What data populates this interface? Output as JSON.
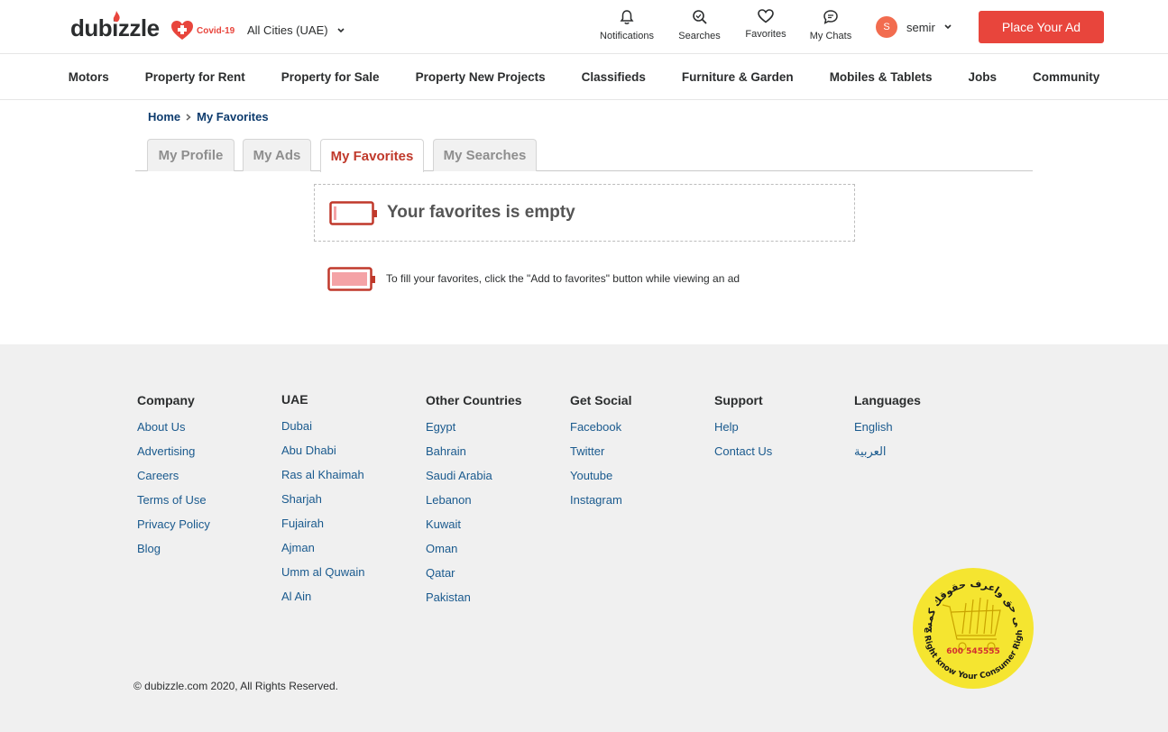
{
  "header": {
    "logo": "dubizzle",
    "covid": "Covid-19",
    "city": "All Cities (UAE)",
    "icons": [
      {
        "label": "Notifications",
        "icon": "bell-icon"
      },
      {
        "label": "Searches",
        "icon": "search-icon"
      },
      {
        "label": "Favorites",
        "icon": "heart-icon"
      },
      {
        "label": "My Chats",
        "icon": "chat-icon"
      }
    ],
    "user": {
      "initial": "S",
      "name": "semir"
    },
    "place_ad": "Place Your Ad"
  },
  "nav": [
    "Motors",
    "Property for Rent",
    "Property for Sale",
    "Property New Projects",
    "Classifieds",
    "Furniture & Garden",
    "Mobiles & Tablets",
    "Jobs",
    "Community"
  ],
  "breadcrumb": {
    "home": "Home",
    "current": "My Favorites"
  },
  "tabs": [
    "My Profile",
    "My Ads",
    "My Favorites",
    "My Searches"
  ],
  "active_tab": "My Favorites",
  "empty": {
    "title": "Your favorites is empty",
    "hint": "To fill your favorites, click the \"Add to favorites\" button while viewing an ad"
  },
  "footer": {
    "columns": [
      {
        "title": "Company",
        "links": [
          "About Us",
          "Advertising",
          "Careers",
          "Terms of Use",
          "Privacy Policy",
          "Blog"
        ]
      },
      {
        "title": "UAE",
        "links": [
          "Dubai",
          "Abu Dhabi",
          "Ras al Khaimah",
          "Sharjah",
          "Fujairah",
          "Ajman",
          "Umm al Quwain",
          "Al Ain"
        ]
      },
      {
        "title": "Other Countries",
        "links": [
          "Egypt",
          "Bahrain",
          "Saudi Arabia",
          "Lebanon",
          "Kuwait",
          "Oman",
          "Qatar",
          "Pakistan"
        ]
      },
      {
        "title": "Get Social",
        "links": [
          "Facebook",
          "Twitter",
          "Youtube",
          "Instagram"
        ]
      },
      {
        "title": "Support",
        "links": [
          "Help",
          "Contact Us"
        ]
      },
      {
        "title": "Languages",
        "links": [
          "English",
          "العربية"
        ]
      }
    ],
    "copyright": "© dubizzle.com 2020, All Rights Reserved.",
    "seal": {
      "top": "كن على حق واعرف حقوقك كمستهلك",
      "bottom": "Be Right know Your Consumer Rights",
      "phone": "600 545555"
    }
  },
  "colors": {
    "brand_red": "#e8453c",
    "link_blue": "#1a5a8e",
    "active_tab": "#c0392b"
  }
}
